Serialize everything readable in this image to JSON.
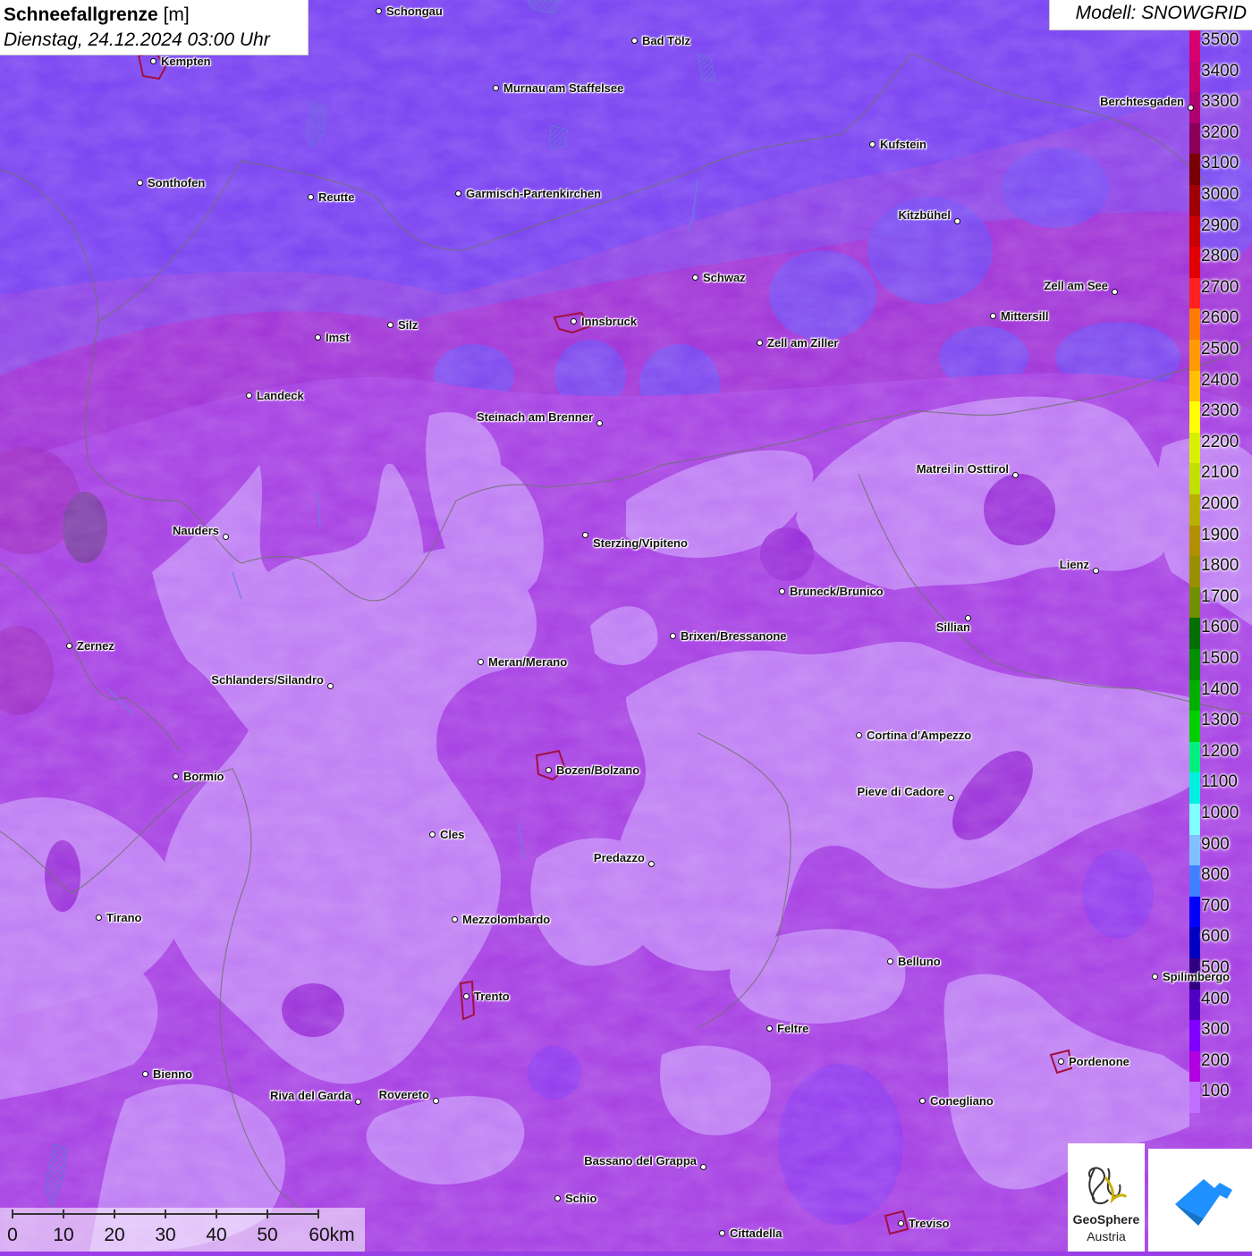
{
  "title": {
    "parameter": "Schneefallgrenze",
    "unit": "[m]",
    "datetime": "Dienstag, 24.12.2024 03:00 Uhr"
  },
  "model": "Modell: SNOWGRID",
  "legend": {
    "labels": [
      "3500",
      "3400",
      "3300",
      "3200",
      "3100",
      "3000",
      "2900",
      "2800",
      "2700",
      "2600",
      "2500",
      "2400",
      "2300",
      "2200",
      "2100",
      "2000",
      "1900",
      "1800",
      "1700",
      "1600",
      "1500",
      "1400",
      "1300",
      "1200",
      "1100",
      "1000",
      "900",
      "800",
      "700",
      "600",
      "500",
      "400",
      "300",
      "200",
      "100"
    ],
    "colors": [
      "#d8006e",
      "#c8006c",
      "#b00070",
      "#8a0058",
      "#780000",
      "#a00000",
      "#c80000",
      "#e00000",
      "#ff2020",
      "#ff7a00",
      "#ff9a00",
      "#ffc000",
      "#ffff00",
      "#d8f000",
      "#c0e000",
      "#b8b000",
      "#b09000",
      "#989000",
      "#709000",
      "#007000",
      "#009000",
      "#00b000",
      "#00d000",
      "#00f080",
      "#00f0e0",
      "#80ffff",
      "#80c0ff",
      "#4080ff",
      "#0000ff",
      "#0000c0",
      "#300080",
      "#5000c0",
      "#8000ff",
      "#b000e0",
      "#c070ff"
    ]
  },
  "cities": [
    {
      "name": "Schongau"
    },
    {
      "name": "Bad Tölz"
    },
    {
      "name": "Kempten"
    },
    {
      "name": "Murnau am Staffelsee"
    },
    {
      "name": "Berchtesgaden"
    },
    {
      "name": "Kufstein"
    },
    {
      "name": "Sonthofen"
    },
    {
      "name": "Reutte"
    },
    {
      "name": "Garmisch-Partenkirchen"
    },
    {
      "name": "Kitzbühel"
    },
    {
      "name": "Schwaz"
    },
    {
      "name": "Zell am See"
    },
    {
      "name": "Mittersill"
    },
    {
      "name": "Innsbruck"
    },
    {
      "name": "Silz"
    },
    {
      "name": "Imst"
    },
    {
      "name": "Zell am Ziller"
    },
    {
      "name": "Landeck"
    },
    {
      "name": "Steinach am Brenner"
    },
    {
      "name": "Matrei in Osttirol"
    },
    {
      "name": "Nauders"
    },
    {
      "name": "Sterzing/Vipiteno"
    },
    {
      "name": "Lienz"
    },
    {
      "name": "Bruneck/Brunico"
    },
    {
      "name": "Sillian"
    },
    {
      "name": "Zernez"
    },
    {
      "name": "Brixen/Bressanone"
    },
    {
      "name": "Meran/Merano"
    },
    {
      "name": "Schlanders/Silandro"
    },
    {
      "name": "Cortina d'Ampezzo"
    },
    {
      "name": "Bozen/Bolzano"
    },
    {
      "name": "Bormio"
    },
    {
      "name": "Pieve di Cadore"
    },
    {
      "name": "Cles"
    },
    {
      "name": "Predazzo"
    },
    {
      "name": "Tirano"
    },
    {
      "name": "Mezzolombardo"
    },
    {
      "name": "Belluno"
    },
    {
      "name": "Spilimbergo"
    },
    {
      "name": "Trento"
    },
    {
      "name": "Feltre"
    },
    {
      "name": "Pordenone"
    },
    {
      "name": "Bienno"
    },
    {
      "name": "Riva del Garda"
    },
    {
      "name": "Rovereto"
    },
    {
      "name": "Conegliano"
    },
    {
      "name": "Bassano del Grappa"
    },
    {
      "name": "Schio"
    },
    {
      "name": "Treviso"
    },
    {
      "name": "Cittadella"
    }
  ],
  "scale": {
    "ticks": [
      "0",
      "10",
      "20",
      "30",
      "40",
      "50",
      "60km"
    ]
  },
  "logo": {
    "name": "GeoSphere",
    "sub": "Austria"
  }
}
